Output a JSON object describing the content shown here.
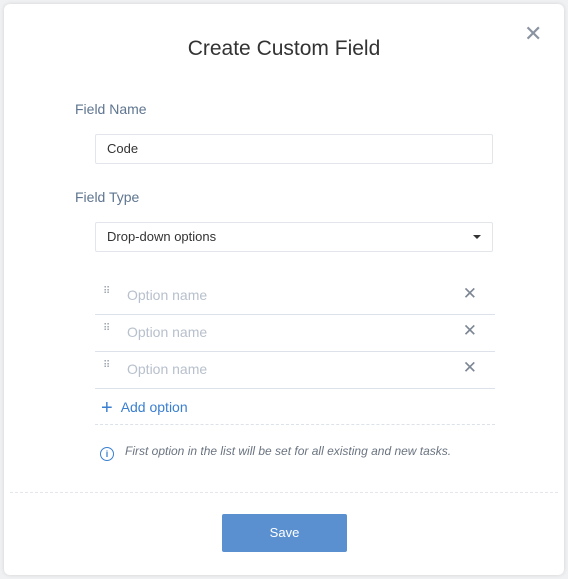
{
  "dialog": {
    "title": "Create Custom Field",
    "close_icon": "close-icon",
    "field_name_label": "Field Name",
    "field_name_value": "Code",
    "field_type_label": "Field Type",
    "field_type_value": "Drop-down options",
    "options": [
      {
        "placeholder": "Option name"
      },
      {
        "placeholder": "Option name"
      },
      {
        "placeholder": "Option name"
      }
    ],
    "add_option_label": "Add option",
    "info_text": "First option in the list will be set for all existing and new tasks.",
    "save_label": "Save",
    "accent_color": "#5a90d0"
  }
}
